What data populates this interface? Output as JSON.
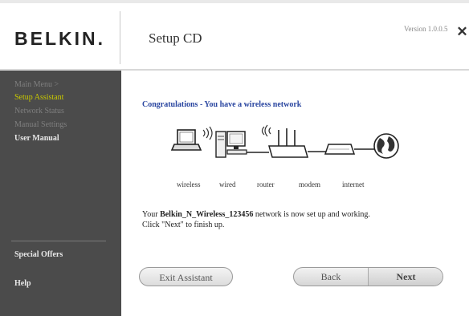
{
  "header": {
    "logo": "BELKIN.",
    "title": "Setup CD",
    "version": "Version 1.0.0.5",
    "close_label": "✕"
  },
  "sidebar": {
    "items": [
      {
        "label": "Main Menu  >"
      },
      {
        "label": "Setup Assistant"
      },
      {
        "label": "Network Status"
      },
      {
        "label": "Manual Settings"
      },
      {
        "label": "User Manual"
      },
      {
        "label": "Special Offers"
      },
      {
        "label": "Help"
      }
    ]
  },
  "main": {
    "heading": "Congratulations - You have a wireless network",
    "diagram_labels": [
      "wireless",
      "wired",
      "router",
      "modem",
      "internet"
    ],
    "message_prefix": "Your ",
    "network_name": "Belkin_N_Wireless_123456",
    "message_suffix": " network is now set up and working.",
    "message_line2": "Click \"Next\" to finish up."
  },
  "buttons": {
    "exit": "Exit Assistant",
    "back": "Back",
    "next": "Next"
  },
  "colors": {
    "sidebar_bg": "#4b4b4b",
    "active_nav": "#c8c800",
    "heading": "#2a46a0"
  }
}
